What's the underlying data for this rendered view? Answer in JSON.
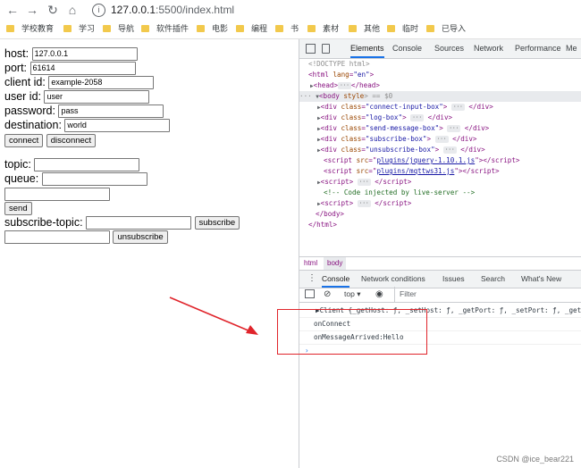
{
  "browser": {
    "url_host": "127.0.0.1",
    "url_rest": ":5500/index.html",
    "bookmarks": [
      "学校教育",
      "学习",
      "导航",
      "软件插件",
      "电影",
      "编程",
      "书",
      "素材",
      "其他",
      "临时",
      "已导入"
    ]
  },
  "form": {
    "host_label": "host:",
    "host_value": "127.0.0.1",
    "port_label": "port:",
    "port_value": "61614",
    "client_label": "client id:",
    "client_value": "example-2058",
    "user_label": "user id:",
    "user_value": "user",
    "password_label": "password:",
    "password_value": "pass",
    "destination_label": "destination:",
    "destination_value": "world",
    "connect": "connect",
    "disconnect": "disconnect",
    "topic_label": "topic:",
    "topic_value": "",
    "queue_label": "queue:",
    "queue_value": "",
    "message_value": "",
    "send": "send",
    "subscribe_label": "subscribe-topic:",
    "subscribe_value": "",
    "subscribe": "subscribe",
    "unsubscribe_value": "",
    "unsubscribe": "unsubscribe"
  },
  "devtools": {
    "tabs": [
      "Elements",
      "Console",
      "Sources",
      "Network",
      "Performance",
      "Me"
    ],
    "active_tab": "Elements",
    "dom": {
      "doctype": "<!DOCTYPE html>",
      "html_open_tag": "<html ",
      "html_lang_attr": "lang",
      "html_lang_val": "\"en\"",
      "html_close": ">",
      "head_open": "<head>",
      "head_close": "</head>",
      "body_open": "<body ",
      "body_style_attr": "style",
      "body_eq": "> == $0",
      "divs": [
        {
          "cls": "\"connect-input-box\""
        },
        {
          "cls": "\"log-box\""
        },
        {
          "cls": "\"send-message-box\""
        },
        {
          "cls": "\"subscribe-box\""
        },
        {
          "cls": "\"unsubscribe-box\""
        }
      ],
      "script1_src": "plugins/jquery-1.10.1.js",
      "script2_src": "plugins/mqttws31.js",
      "comment": "<!-- Code injected by live-server -->",
      "body_close": "</body>",
      "html_close_tag": "</html>"
    },
    "crumbs": [
      "html",
      "body"
    ],
    "console_tabs": [
      "Console",
      "Network conditions",
      "Issues",
      "Search",
      "What's New"
    ],
    "console_context": "top",
    "filter_placeholder": "Filter",
    "console_lines": [
      "▶Client {_getHost: ƒ, _setHost: ƒ, _getPort: ƒ, _setPort: ƒ, _get",
      "onConnect",
      "onMessageArrived:Hello"
    ],
    "prompt": "›"
  },
  "watermark": "CSDN @ice_bear221"
}
